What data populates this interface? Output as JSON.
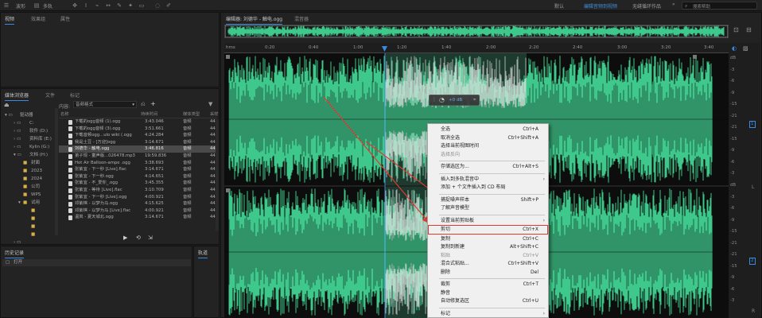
{
  "toolbar": {
    "waveform": "波形",
    "multitrack": "多轨",
    "workspaces": [
      "默认",
      "编辑音频到视频",
      "无缝循环作品"
    ],
    "active_workspace_index": 1,
    "more": "»",
    "search_placeholder": "搜索帮助"
  },
  "left_top_tabs": [
    "视频",
    "效果组",
    "属性"
  ],
  "media_panel": {
    "tabs": [
      "媒体浏览器",
      "文件",
      "标记"
    ],
    "content_label": "内容:",
    "content_value": "音频格式",
    "tree": [
      "驱动器",
      "C:",
      "软件 (D:)",
      "资料库 (E:)",
      "Kylin (G:)",
      "文档 (H:)",
      "封面",
      "2023",
      "2024",
      "公司",
      "WPS",
      "试用",
      "",
      "",
      "",
      "",
      "",
      ""
    ],
    "columns": [
      "名称",
      "持续时间",
      "媒体类型",
      "采样"
    ],
    "files": [
      {
        "name": "下载的ogg音频 (1).ogg",
        "dur": "3:43.046",
        "type": "音频",
        "rate": "44"
      },
      {
        "name": "下载的ogg音频 (3).ogg",
        "dur": "3:51.661",
        "type": "音频",
        "rate": "44"
      },
      {
        "name": "下载音频ogg...ulo wiki (.ogg",
        "dur": "4:24.284",
        "type": "音频",
        "rate": "44"
      },
      {
        "name": "我是土豆 - [万迎]ogg",
        "dur": "3:14.671",
        "type": "音频",
        "rate": "44"
      },
      {
        "name": "刘德华 - 触电.ogg",
        "dur": "3:46.816",
        "type": "音频",
        "rate": "44"
      },
      {
        "name": "弟子规 - 童声版...026478.mp3",
        "dur": "19:59.836",
        "type": "音频",
        "rate": "44"
      },
      {
        "name": "Hot Air Balloon-ampe .ogg",
        "dur": "3:38.693",
        "type": "音频",
        "rate": "44"
      },
      {
        "name": "张紫宜 - 下一秒 [Live].flac",
        "dur": "3:14.671",
        "type": "音频",
        "rate": "44"
      },
      {
        "name": "张紫宜 - 下一秒.ogg",
        "dur": "4:14.651",
        "type": "音频",
        "rate": "44"
      },
      {
        "name": "张紫宜 - 不_爱你_.ogg",
        "dur": "3:45.355",
        "type": "音频",
        "rate": "44"
      },
      {
        "name": "张紫宜 - 等待 [Live].flac",
        "dur": "3:10.709",
        "type": "音频",
        "rate": "44"
      },
      {
        "name": "张紫宜 - 下一秒 [Live].ogg",
        "dur": "4:00.921",
        "type": "音频",
        "rate": "44"
      },
      {
        "name": "邓紫棋 - 以梦为马.ogg",
        "dur": "4:15.625",
        "type": "音频",
        "rate": "44"
      },
      {
        "name": "邓紫棋 - 以梦为马 [Live].flac",
        "dur": "4:00.921",
        "type": "音频",
        "rate": "44"
      },
      {
        "name": "温岚 - 夏天城北.ogg",
        "dur": "3:14.671",
        "type": "音频",
        "rate": "44"
      }
    ],
    "selected_index": 4
  },
  "history_panel": {
    "title": "历史记录",
    "items": [
      "打开"
    ]
  },
  "tracks_panel": {
    "title": "轨道"
  },
  "editor": {
    "tabs": [
      "编辑器: 刘德华 - 触电.ogg",
      "混音器"
    ],
    "ruler_labels": [
      "hms",
      "0:20",
      "0:40",
      "1:00",
      "1:20",
      "1:40",
      "2:00",
      "2:20",
      "2:40",
      "3:00",
      "3:20",
      "3:40"
    ],
    "db_labels": [
      "dB",
      "-3",
      "-6",
      "-9",
      "-15",
      "-21",
      "-21",
      "-15",
      "-9",
      "-6",
      "-3",
      "dB",
      "-3",
      "-6",
      "-9",
      "-15",
      "-21",
      "-21",
      "-15",
      "-9",
      "-6",
      "-3"
    ],
    "hud_value": "+0 dB",
    "channel_l": "L",
    "channel_r": "R",
    "channel_num_1": "1",
    "channel_num_2": "2"
  },
  "context_menu": {
    "items": [
      {
        "label": "全选",
        "shortcut": "Ctrl+A",
        "disabled": false
      },
      {
        "label": "取消全选",
        "shortcut": "Ctrl+Shift+A",
        "disabled": false
      },
      {
        "label": "选择当前视图时间",
        "shortcut": "",
        "disabled": false
      },
      {
        "label": "选择反向",
        "shortcut": "",
        "disabled": true
      },
      {
        "sep": true
      },
      {
        "label": "存储选区为...",
        "shortcut": "Ctrl+Alt+S",
        "disabled": false
      },
      {
        "sep": true
      },
      {
        "label": "插入到多轨混音中",
        "shortcut": "",
        "disabled": false,
        "submenu": true
      },
      {
        "label": "添加 + 个文件插入到 CD 布局",
        "shortcut": "",
        "disabled": false
      },
      {
        "sep": true
      },
      {
        "label": "捕捉噪声样本",
        "shortcut": "Shift+P",
        "disabled": false
      },
      {
        "label": "了解声音模型",
        "shortcut": "",
        "disabled": false
      },
      {
        "sep": true
      },
      {
        "label": "设置当前剪贴板",
        "shortcut": "",
        "disabled": false,
        "submenu": true
      },
      {
        "label": "剪切",
        "shortcut": "Ctrl+X",
        "disabled": false,
        "highlight": true
      },
      {
        "label": "复制",
        "shortcut": "Ctrl+C",
        "disabled": false
      },
      {
        "label": "复制到新建",
        "shortcut": "Alt+Shift+C",
        "disabled": false
      },
      {
        "label": "粘贴",
        "shortcut": "Ctrl+V",
        "disabled": true
      },
      {
        "label": "混合式粘贴...",
        "shortcut": "Ctrl+Shift+V",
        "disabled": false
      },
      {
        "label": "删除",
        "shortcut": "Del",
        "disabled": false
      },
      {
        "sep": true
      },
      {
        "label": "裁剪",
        "shortcut": "Ctrl+T",
        "disabled": false
      },
      {
        "label": "静音",
        "shortcut": "",
        "disabled": false
      },
      {
        "label": "自动修复选区",
        "shortcut": "Ctrl+U",
        "disabled": false
      },
      {
        "sep": true
      },
      {
        "label": "标记",
        "shortcut": "",
        "disabled": false,
        "submenu": true
      }
    ]
  },
  "colors": {
    "wave": "#3ec88b",
    "wave_dark": "#1f6b4a",
    "accent": "#3b8ae0",
    "highlight_box": "#e03a2e"
  }
}
